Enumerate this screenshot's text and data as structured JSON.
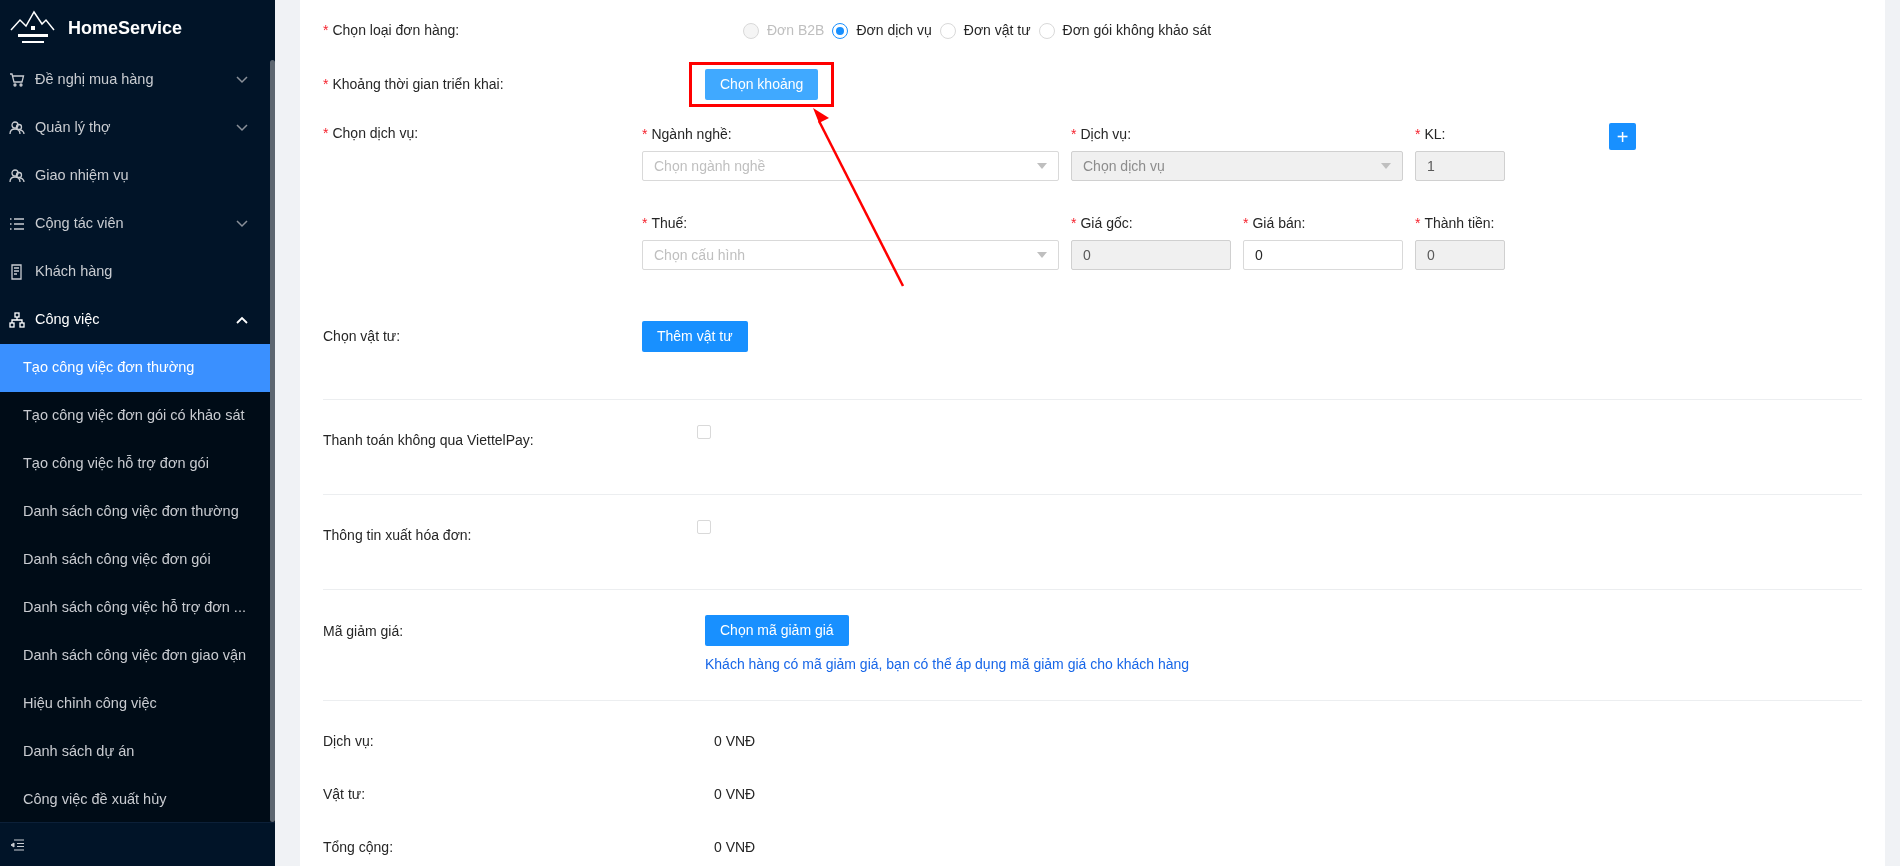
{
  "required_mark": "*",
  "sidebar": {
    "brand": "HomeService",
    "items": [
      {
        "label": "Đề nghị mua hàng",
        "kind": "cart",
        "expanded": false
      },
      {
        "label": "Quản lý thợ",
        "kind": "people",
        "expanded": false
      },
      {
        "label": "Giao nhiệm vụ",
        "kind": "people"
      },
      {
        "label": "Cộng tác viên",
        "kind": "list",
        "expanded": false
      },
      {
        "label": "Khách hàng",
        "kind": "document"
      },
      {
        "label": "Công việc",
        "kind": "sitemap",
        "expanded": true,
        "children": [
          {
            "label": "Tạo công việc đơn thường",
            "selected": true
          },
          {
            "label": "Tạo công việc đơn gói có khảo sát",
            "selected": false
          },
          {
            "label": "Tạo công việc hỗ trợ đơn gói",
            "selected": false
          },
          {
            "label": "Danh sách công việc đơn thường",
            "selected": false
          },
          {
            "label": "Danh sách công việc đơn gói",
            "selected": false
          },
          {
            "label": "Danh sách công việc hỗ trợ đơn ...",
            "selected": false
          },
          {
            "label": "Danh sách công việc đơn giao vận",
            "selected": false
          },
          {
            "label": "Hiệu chỉnh công việc",
            "selected": false
          },
          {
            "label": "Danh sách dự án",
            "selected": false
          },
          {
            "label": "Công việc đề xuất hủy",
            "selected": false
          }
        ]
      }
    ]
  },
  "order_type": {
    "label": "Chọn loại đơn hàng:",
    "required": true,
    "options": [
      {
        "label": "Đơn B2B",
        "selected": false,
        "disabled": true
      },
      {
        "label": "Đơn dịch vụ",
        "selected": true,
        "disabled": false
      },
      {
        "label": "Đơn vật tư",
        "selected": false,
        "disabled": false
      },
      {
        "label": "Đơn gói không khảo sát",
        "selected": false,
        "disabled": false
      }
    ]
  },
  "deploy_period": {
    "label": "Khoảng thời gian triển khai:",
    "required": true,
    "button": "Chọn khoảng",
    "highlighted": true
  },
  "service": {
    "label": "Chọn dịch vụ:",
    "required": true,
    "add_button": "+",
    "rows": [
      [
        {
          "label": "Ngành nghề:",
          "required": true,
          "kind": "select",
          "placeholder": "Chọn ngành nghề",
          "disabled": false
        },
        {
          "label": "Dịch vụ:",
          "required": true,
          "kind": "select",
          "placeholder": "Chọn dịch vụ",
          "disabled": true
        },
        "",
        {
          "label": "KL:",
          "required": true,
          "kind": "input",
          "value": "1",
          "disabled": true
        }
      ],
      [
        {
          "label": "Thuế:",
          "required": true,
          "kind": "select",
          "placeholder": "Chọn cấu hình",
          "disabled": false
        },
        {
          "label": "Giá gốc:",
          "required": true,
          "kind": "input",
          "value": "0",
          "disabled": true
        },
        {
          "label": "Giá bán:",
          "required": true,
          "kind": "input",
          "value": "0",
          "disabled": false
        },
        {
          "label": "Thành tiền:",
          "required": true,
          "kind": "input",
          "value": "0",
          "disabled": true
        }
      ]
    ]
  },
  "materials": {
    "label": "Chọn vật tư:",
    "button": "Thêm vật tư"
  },
  "checks": [
    {
      "label": "Thanh toán không qua ViettelPay:",
      "checked": false
    },
    {
      "label": "Thông tin xuất hóa đơn:",
      "checked": false
    }
  ],
  "discount": {
    "label": "Mã giảm giá:",
    "button": "Chọn mã giảm giá",
    "hint": "Khách hàng có mã giảm giá, bạn có thể áp dụng mã giảm giá cho khách hàng"
  },
  "totals": [
    {
      "label": "Dịch vụ:",
      "value": "0 VNĐ"
    },
    {
      "label": "Vật tư:",
      "value": "0 VNĐ"
    },
    {
      "label": "Tổng cộng:",
      "value": "0 VNĐ"
    }
  ]
}
